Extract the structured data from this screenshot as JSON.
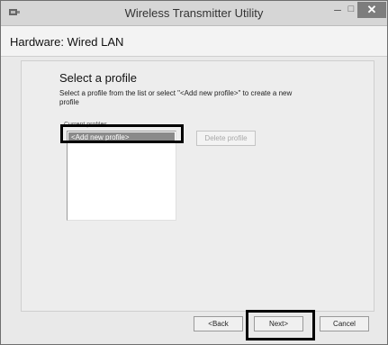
{
  "window": {
    "title": "Wireless Transmitter Utility",
    "minimize_glyph": "–",
    "maximize_glyph": "□",
    "close_glyph": "✕"
  },
  "header": {
    "hardware_label": "Hardware: Wired LAN"
  },
  "content": {
    "heading": "Select a profile",
    "instructions": "Select a profile from the list or select \"<Add new profile>\" to create a new profile",
    "list_label": "Current profiles",
    "profiles": [
      {
        "label": "<Add new profile>",
        "selected": true
      }
    ],
    "delete_button": "Delete profile"
  },
  "footer": {
    "back_button": "<Back",
    "next_button": "Next>",
    "cancel_button": "Cancel"
  },
  "icons": {
    "app_icon": "network-adapter-icon"
  }
}
